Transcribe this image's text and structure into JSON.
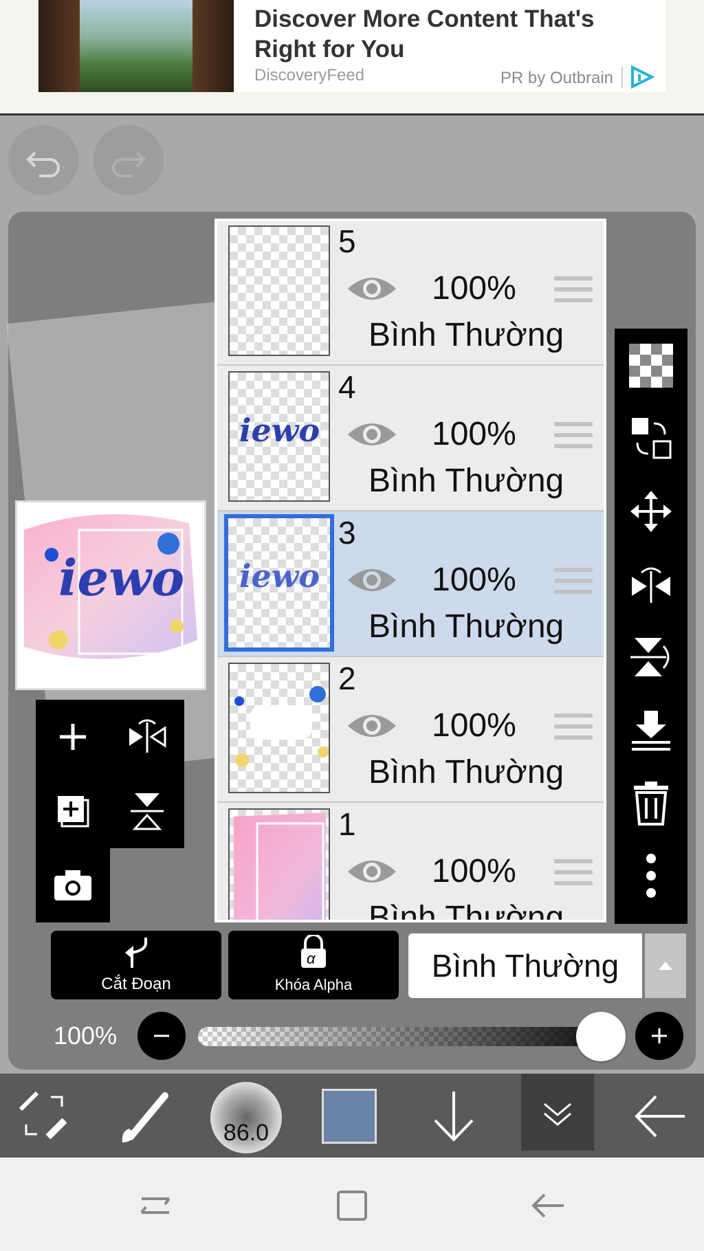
{
  "ad": {
    "title": "Discover More Content That's Right for You",
    "source": "DiscoveryFeed",
    "pr": "PR by Outbrain"
  },
  "layers": [
    {
      "number": "5",
      "opacity": "100%",
      "mode": "Bình Thường",
      "selected": false
    },
    {
      "number": "4",
      "opacity": "100%",
      "mode": "Bình Thường",
      "selected": false
    },
    {
      "number": "3",
      "opacity": "100%",
      "mode": "Bình Thường",
      "selected": true
    },
    {
      "number": "2",
      "opacity": "100%",
      "mode": "Bình Thường",
      "selected": false
    },
    {
      "number": "1",
      "opacity": "100%",
      "mode": "Bình Thường",
      "selected": false
    }
  ],
  "bottom_row": {
    "clip_label": "Cắt Đoạn",
    "alpha_lock_label": "Khóa Alpha",
    "alpha_icon": "α",
    "blend_mode": "Bình Thường"
  },
  "opacity_control": {
    "label": "100%",
    "level": 1.0
  },
  "toolbar": {
    "brush_size": "86.0",
    "color": "#6a84a8"
  },
  "colors": {
    "selected_layer_bg": "#cdd9ec",
    "selected_border": "#2f6fd8",
    "panel_bg": "#7e7e7e"
  }
}
